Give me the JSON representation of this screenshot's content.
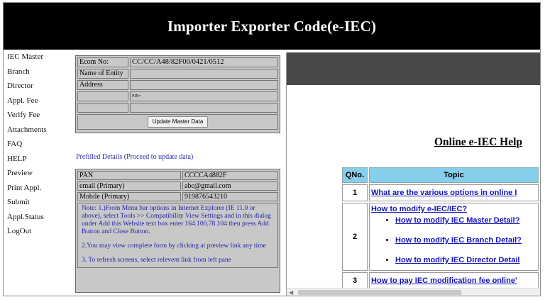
{
  "header": {
    "title": "Importer Exporter Code(e-IEC)"
  },
  "sidebar": {
    "items": [
      {
        "label": "IEC Master"
      },
      {
        "label": "Branch"
      },
      {
        "label": "Director"
      },
      {
        "label": "Appl. Fee"
      },
      {
        "label": "Verify Fee"
      },
      {
        "label": "Attachments"
      },
      {
        "label": "FAQ"
      },
      {
        "label": "HELP"
      },
      {
        "label": "Preview"
      },
      {
        "label": "Print Appl."
      },
      {
        "label": "Submit"
      },
      {
        "label": "Appl.Status"
      },
      {
        "label": "LogOut"
      }
    ]
  },
  "master": {
    "ecom_label": "Ecom No:",
    "ecom_value": "CC/CC/A48/82F00/0421/0512",
    "entity_label": "Name of Entity",
    "address_label": "Address",
    "pin_value": "PIN=",
    "update_button": "Update Master Data"
  },
  "prefill": {
    "text": "Prefilled Details (Proceed to update data)"
  },
  "details": {
    "pan_label": "PAN",
    "pan_value": "CCCCA4882F",
    "email_label": "email (Primary)",
    "email_value": "abc@gmail.com",
    "mobile_label": "Mobile (Primary)",
    "mobile_value": "919876543210",
    "note1": "Note: 1.)From Menu bar options in Internet Explorer (IE 11.0 or above), select Tools >> Compatibility View Settings and in this dialog under Add this Website text box enter 164.100.78.104 then press Add Button and Close Button.",
    "note2": "2.You may view complete form by clicking at preview link any time",
    "note3": "3. To refresh screens, select relevent link from left pane"
  },
  "help": {
    "title": "Online e-IEC Help",
    "col_qno": "QNo.",
    "col_topic": "Topic",
    "rows": [
      {
        "num": "1",
        "topic": "What are the various options in online I"
      },
      {
        "num": "2",
        "topic": "How to modify e-IEC/IEC?",
        "sub": [
          "How to modify IEC Master Detail?",
          "How to modify IEC Branch Detail?",
          "How to modify IEC Director Detail"
        ]
      },
      {
        "num": "3",
        "topic": "How to pay IEC modification fee online'"
      }
    ]
  },
  "colors": {
    "header_bg": "#000000",
    "panel_gray": "#c8c8c8",
    "link_blue": "#1515b8",
    "table_header": "#87ceeb"
  }
}
